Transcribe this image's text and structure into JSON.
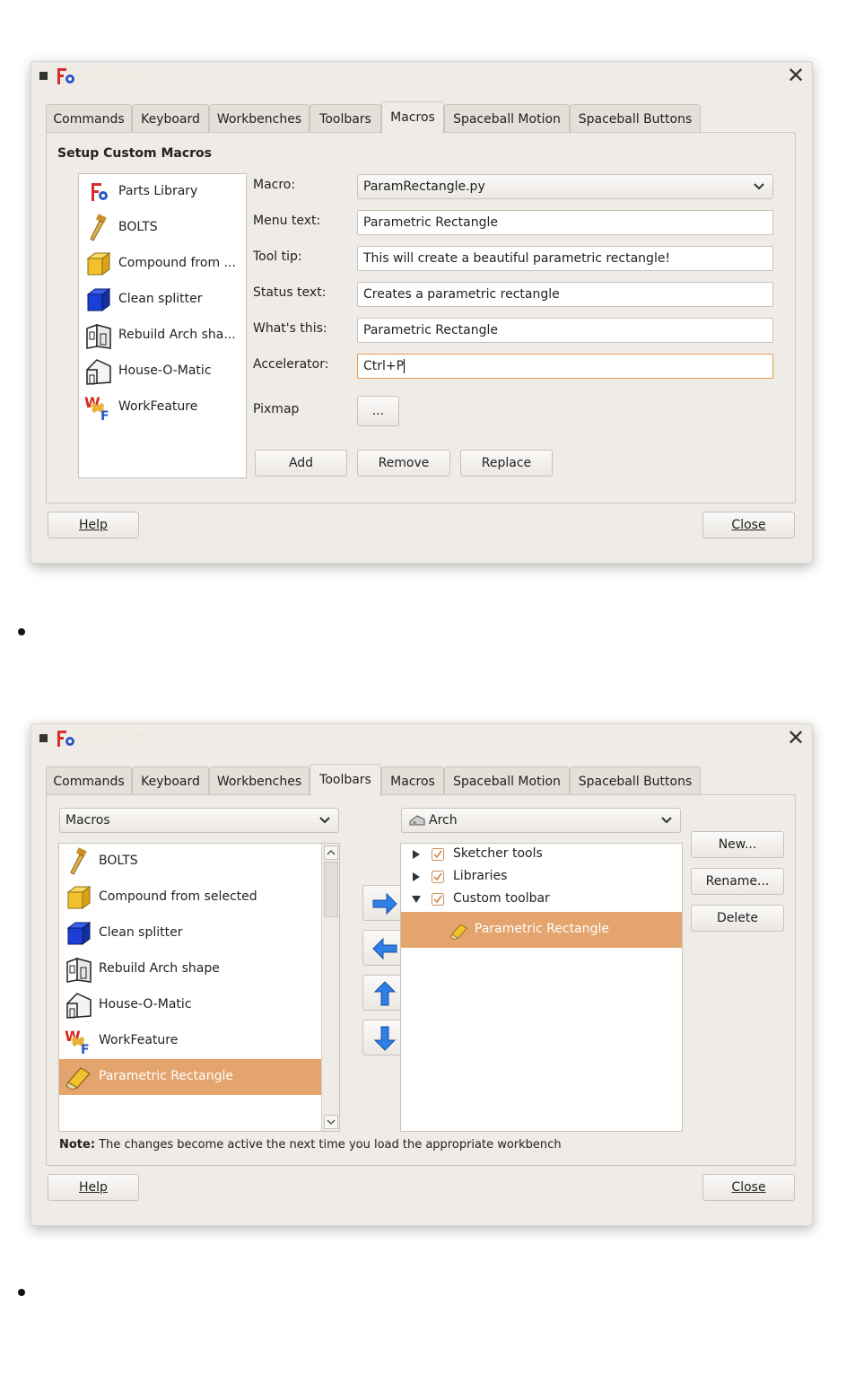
{
  "dialog_macros": {
    "title": "Customize",
    "tabs": [
      "Commands",
      "Keyboard",
      "Workbenches",
      "Toolbars",
      "Macros",
      "Spaceball Motion",
      "Spaceball Buttons"
    ],
    "active_tab": "Macros",
    "section_title": "Setup Custom Macros",
    "macro_list": [
      {
        "label": "Parts Library",
        "icon": "freecad-logo-icon"
      },
      {
        "label": "BOLTS",
        "icon": "bolt-icon"
      },
      {
        "label": "Compound from ...",
        "icon": "yellow-cube-icon"
      },
      {
        "label": "Clean splitter",
        "icon": "blue-cube-icon"
      },
      {
        "label": "Rebuild Arch sha...",
        "icon": "arch-shape-icon"
      },
      {
        "label": "House-O-Matic",
        "icon": "house-icon"
      },
      {
        "label": "WorkFeature",
        "icon": "workfeature-icon"
      }
    ],
    "fields": {
      "macro_label": "Macro:",
      "macro_value": "ParamRectangle.py",
      "menu_text_label": "Menu text:",
      "menu_text_value": "Parametric Rectangle",
      "tool_tip_label": "Tool tip:",
      "tool_tip_value": "This will create a beautiful parametric rectangle!",
      "status_text_label": "Status text:",
      "status_text_value": "Creates a parametric rectangle",
      "whats_this_label": "What's this:",
      "whats_this_value": "Parametric Rectangle",
      "accelerator_label": "Accelerator:",
      "accelerator_value": "Ctrl+P",
      "pixmap_label": "Pixmap",
      "pixmap_button": "..."
    },
    "actions": {
      "add": "Add",
      "remove": "Remove",
      "replace": "Replace"
    },
    "help": "Help",
    "close": "Close"
  },
  "dialog_toolbars": {
    "title": "Customize",
    "tabs": [
      "Commands",
      "Keyboard",
      "Workbenches",
      "Toolbars",
      "Macros",
      "Spaceball Motion",
      "Spaceball Buttons"
    ],
    "active_tab": "Toolbars",
    "category_combo": "Macros",
    "workbench_combo": "Arch",
    "command_list": [
      {
        "label": "BOLTS",
        "icon": "bolt-icon"
      },
      {
        "label": "Compound from selected",
        "icon": "yellow-cube-icon"
      },
      {
        "label": "Clean splitter",
        "icon": "blue-cube-icon"
      },
      {
        "label": "Rebuild Arch shape",
        "icon": "arch-shape-icon"
      },
      {
        "label": "House-O-Matic",
        "icon": "house-icon"
      },
      {
        "label": "WorkFeature",
        "icon": "workfeature-icon"
      },
      {
        "label": "Parametric Rectangle",
        "icon": "pencil-rectangle-icon",
        "selected": true
      }
    ],
    "toolbar_tree": [
      {
        "label": "Sketcher tools",
        "expanded": false,
        "checked": true
      },
      {
        "label": "Libraries",
        "expanded": false,
        "checked": true
      },
      {
        "label": "Custom toolbar",
        "expanded": true,
        "checked": true
      }
    ],
    "toolbar_child": "Parametric Rectangle",
    "side_buttons": {
      "new": "New...",
      "rename": "Rename...",
      "delete": "Delete"
    },
    "note_bold": "Note:",
    "note_text": "The changes become active the next time you load the appropriate workbench",
    "help": "Help",
    "close": "Close"
  },
  "colors": {
    "selection": "#e3a46d",
    "dialog_bg": "#efebe7",
    "arrow_blue": "#2f7fe6",
    "focus_border": "#e89b52"
  }
}
